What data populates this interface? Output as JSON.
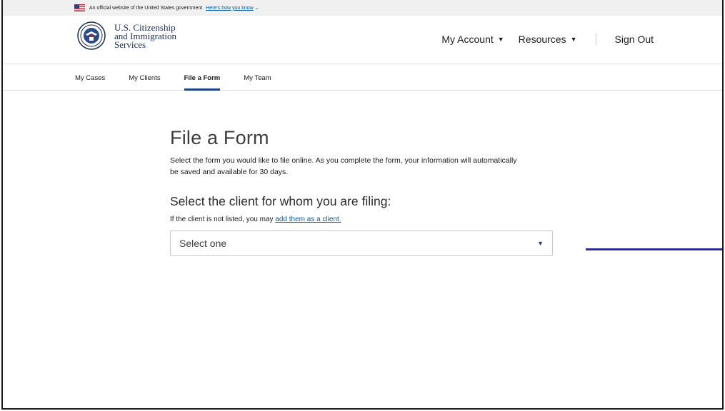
{
  "gov_banner": {
    "text": "An official website of the United States government",
    "link": "Here's how you know",
    "chevron": "⌄"
  },
  "header": {
    "agency_lines": [
      "U.S. Citizenship",
      "and Immigration",
      "Services"
    ],
    "nav": [
      {
        "label": "My Account",
        "caret": "▼"
      },
      {
        "label": "Resources",
        "caret": "▼"
      }
    ],
    "sign_out": "Sign Out"
  },
  "tabs": [
    {
      "label": "My Cases",
      "active": false
    },
    {
      "label": "My Clients",
      "active": false
    },
    {
      "label": "File a Form",
      "active": true
    },
    {
      "label": "My Team",
      "active": false
    }
  ],
  "main": {
    "title": "File a Form",
    "intro": "Select the form you would like to file online. As you complete the form, your information will automatically be saved and available for 30 days.",
    "section_title": "Select the client for whom you are filing:",
    "hint_prefix": "If the client is not listed, you may ",
    "hint_link": "add them as a client.",
    "select_value": "Select one"
  },
  "colors": {
    "link": "#005ea2",
    "tab_underline": "#1a4480",
    "callout": "#2e2f8f"
  }
}
